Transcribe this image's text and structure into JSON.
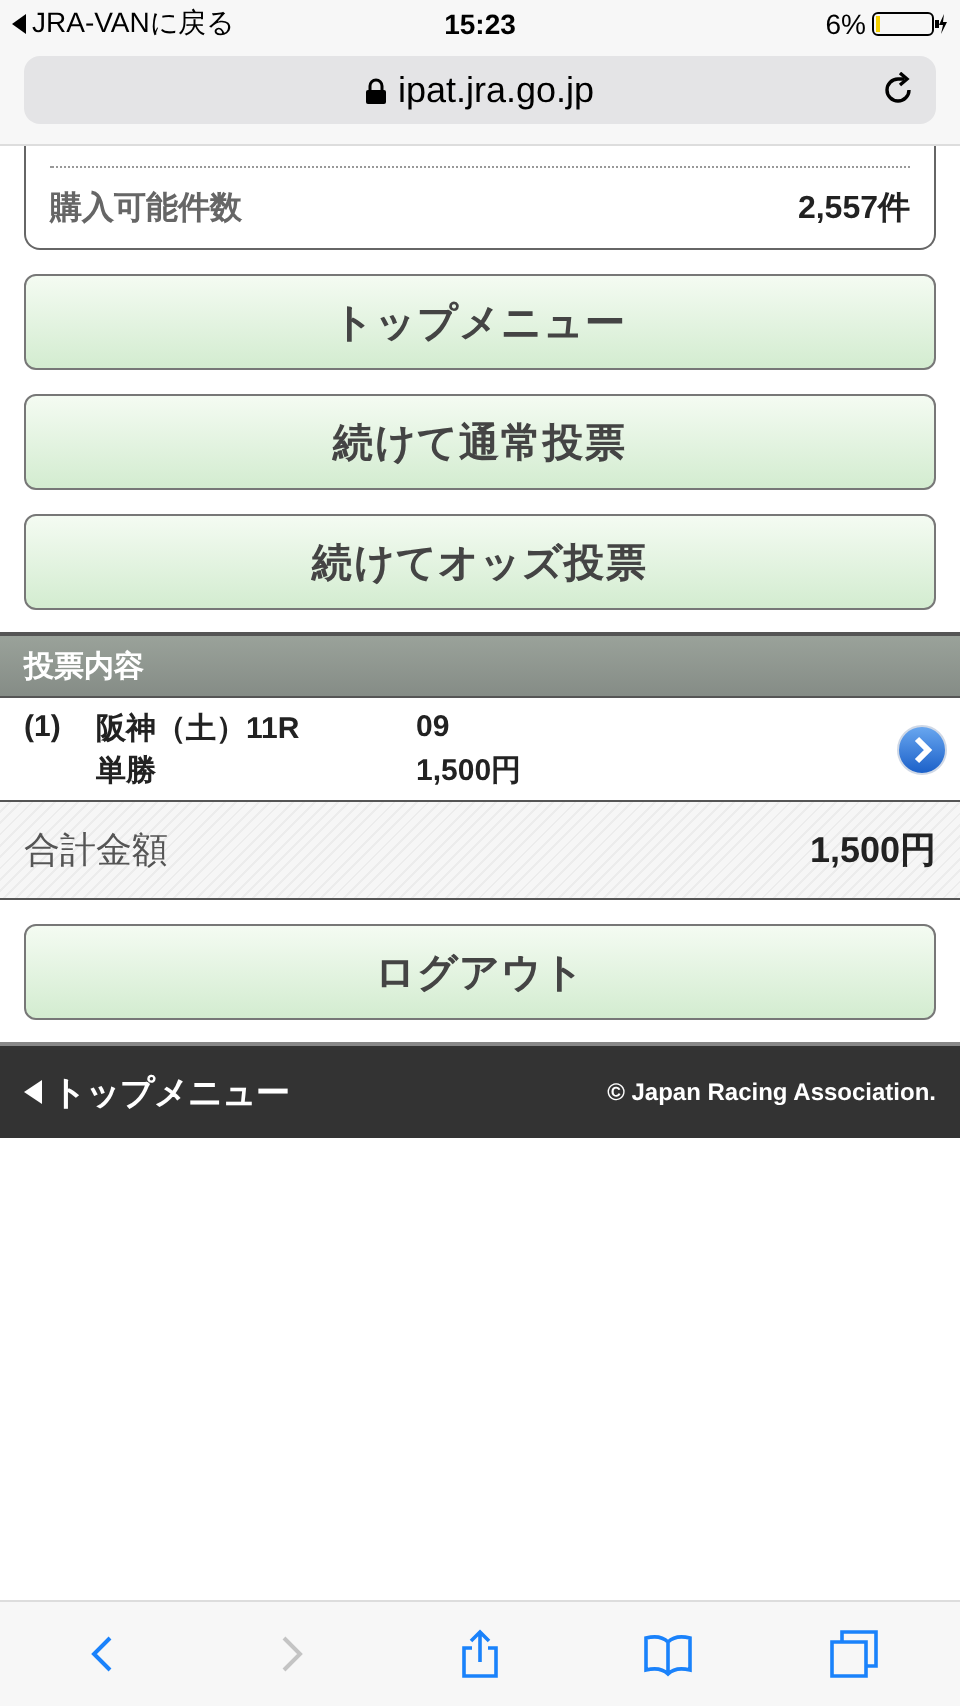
{
  "status_bar": {
    "back_app": "JRA-VANに戻る",
    "time": "15:23",
    "battery": "6%"
  },
  "address_bar": {
    "url": "ipat.jra.go.jp"
  },
  "summary": {
    "label": "購入可能件数",
    "value": "2,557件"
  },
  "menu_buttons": [
    "トップメニュー",
    "続けて通常投票",
    "続けてオッズ投票"
  ],
  "bets": {
    "title": "投票内容",
    "items": [
      {
        "index": "(1)",
        "race": "阪神（土）11R",
        "bet_type": "単勝",
        "selection": "09",
        "amount": "1,500円"
      }
    ]
  },
  "total": {
    "label": "合計金額",
    "value": "1,500円"
  },
  "logout_button": "ログアウト",
  "footer": {
    "back_link": "トップメニュー",
    "copyright": "© Japan Racing Association."
  },
  "toolbar": [
    {
      "kind": "back",
      "disabled": false
    },
    {
      "kind": "forward",
      "disabled": true
    },
    {
      "kind": "share",
      "disabled": false
    },
    {
      "kind": "bookmarks",
      "disabled": false
    },
    {
      "kind": "tabs",
      "disabled": false
    }
  ]
}
